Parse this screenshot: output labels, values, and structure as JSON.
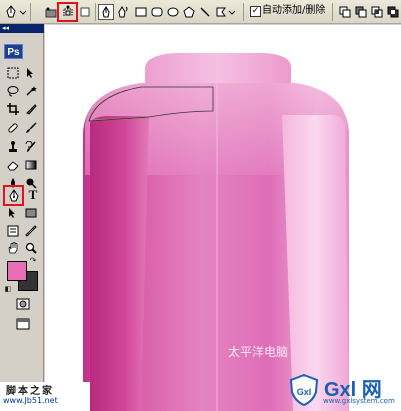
{
  "options_bar": {
    "tools": [
      {
        "name": "pen-tool-preset-icon"
      },
      {
        "name": "shape-layers-icon"
      },
      {
        "name": "paths-mode-icon",
        "highlighted": true
      },
      {
        "name": "fill-pixels-icon"
      },
      {
        "name": "pen-icon"
      },
      {
        "name": "freeform-pen-icon"
      },
      {
        "name": "rectangle-icon"
      },
      {
        "name": "rounded-rectangle-icon"
      },
      {
        "name": "ellipse-icon"
      },
      {
        "name": "polygon-icon"
      },
      {
        "name": "line-icon"
      },
      {
        "name": "custom-shape-icon"
      }
    ],
    "auto_add_delete": {
      "label": "自动添加/删除",
      "checked": true
    }
  },
  "toolbox": {
    "header": "◂◂",
    "logo": "Ps",
    "highlighted_tool": "pen-tool-icon"
  },
  "colors": {
    "foreground": "#e66fb5",
    "background": "#333333",
    "highlight_border": "#e0141e",
    "bottle_dark": "#c93a8c",
    "bottle_mid": "#e27cbc",
    "bottle_light": "#f7c3e3"
  },
  "watermarks": {
    "left_title": "脚本之家",
    "left_url": "www.Jb51.net",
    "canvas_text": "太平洋电脑",
    "right_brand": "Gxl 网",
    "right_url": "www.gxlsystem.com"
  }
}
